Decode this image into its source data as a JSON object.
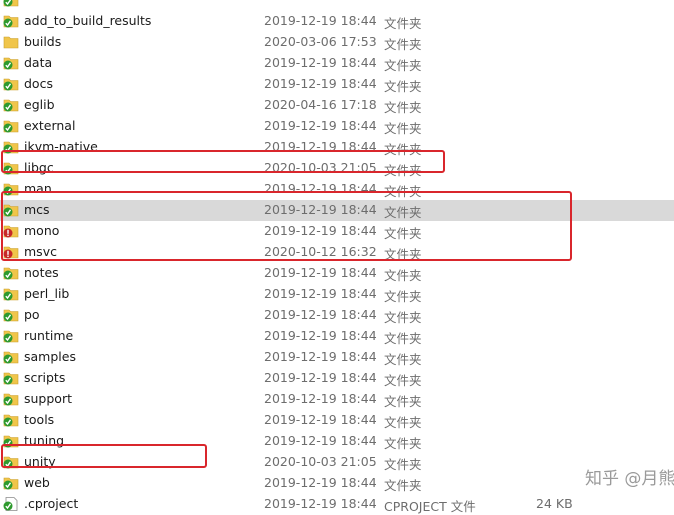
{
  "files": [
    {
      "name": "",
      "date": "",
      "type": "",
      "size": "",
      "status": "ok",
      "kind": "folder"
    },
    {
      "name": "add_to_build_results",
      "date": "2019-12-19 18:44",
      "type": "文件夹",
      "size": "",
      "status": "ok",
      "kind": "folder"
    },
    {
      "name": "builds",
      "date": "2020-03-06 17:53",
      "type": "文件夹",
      "size": "",
      "status": "none",
      "kind": "folder"
    },
    {
      "name": "data",
      "date": "2019-12-19 18:44",
      "type": "文件夹",
      "size": "",
      "status": "ok",
      "kind": "folder"
    },
    {
      "name": "docs",
      "date": "2019-12-19 18:44",
      "type": "文件夹",
      "size": "",
      "status": "ok",
      "kind": "folder"
    },
    {
      "name": "eglib",
      "date": "2020-04-16 17:18",
      "type": "文件夹",
      "size": "",
      "status": "ok",
      "kind": "folder"
    },
    {
      "name": "external",
      "date": "2019-12-19 18:44",
      "type": "文件夹",
      "size": "",
      "status": "ok",
      "kind": "folder"
    },
    {
      "name": "ikvm-native",
      "date": "2019-12-19 18:44",
      "type": "文件夹",
      "size": "",
      "status": "ok",
      "kind": "folder"
    },
    {
      "name": "libgc",
      "date": "2020-10-03 21:05",
      "type": "文件夹",
      "size": "",
      "status": "ok",
      "kind": "folder"
    },
    {
      "name": "man",
      "date": "2019-12-19 18:44",
      "type": "文件夹",
      "size": "",
      "status": "ok",
      "kind": "folder"
    },
    {
      "name": "mcs",
      "date": "2019-12-19 18:44",
      "type": "文件夹",
      "size": "",
      "status": "ok",
      "kind": "folder",
      "selected": true
    },
    {
      "name": "mono",
      "date": "2019-12-19 18:44",
      "type": "文件夹",
      "size": "",
      "status": "modified",
      "kind": "folder"
    },
    {
      "name": "msvc",
      "date": "2020-10-12 16:32",
      "type": "文件夹",
      "size": "",
      "status": "modified",
      "kind": "folder"
    },
    {
      "name": "notes",
      "date": "2019-12-19 18:44",
      "type": "文件夹",
      "size": "",
      "status": "ok",
      "kind": "folder"
    },
    {
      "name": "perl_lib",
      "date": "2019-12-19 18:44",
      "type": "文件夹",
      "size": "",
      "status": "ok",
      "kind": "folder"
    },
    {
      "name": "po",
      "date": "2019-12-19 18:44",
      "type": "文件夹",
      "size": "",
      "status": "ok",
      "kind": "folder"
    },
    {
      "name": "runtime",
      "date": "2019-12-19 18:44",
      "type": "文件夹",
      "size": "",
      "status": "ok",
      "kind": "folder"
    },
    {
      "name": "samples",
      "date": "2019-12-19 18:44",
      "type": "文件夹",
      "size": "",
      "status": "ok",
      "kind": "folder"
    },
    {
      "name": "scripts",
      "date": "2019-12-19 18:44",
      "type": "文件夹",
      "size": "",
      "status": "ok",
      "kind": "folder"
    },
    {
      "name": "support",
      "date": "2019-12-19 18:44",
      "type": "文件夹",
      "size": "",
      "status": "ok",
      "kind": "folder"
    },
    {
      "name": "tools",
      "date": "2019-12-19 18:44",
      "type": "文件夹",
      "size": "",
      "status": "ok",
      "kind": "folder"
    },
    {
      "name": "tuning",
      "date": "2019-12-19 18:44",
      "type": "文件夹",
      "size": "",
      "status": "ok",
      "kind": "folder"
    },
    {
      "name": "unity",
      "date": "2020-10-03 21:05",
      "type": "文件夹",
      "size": "",
      "status": "ok",
      "kind": "folder"
    },
    {
      "name": "web",
      "date": "2019-12-19 18:44",
      "type": "文件夹",
      "size": "",
      "status": "ok",
      "kind": "folder"
    },
    {
      "name": ".cproject",
      "date": "2019-12-19 18:44",
      "type": "CPROJECT 文件",
      "size": "24 KB",
      "status": "ok",
      "kind": "file"
    }
  ],
  "watermark": "知乎 @月熊",
  "colors": {
    "highlight": "#d9262c",
    "ok": "#2e9a2e",
    "modified": "#c62828",
    "folder": "#f0c54a"
  }
}
